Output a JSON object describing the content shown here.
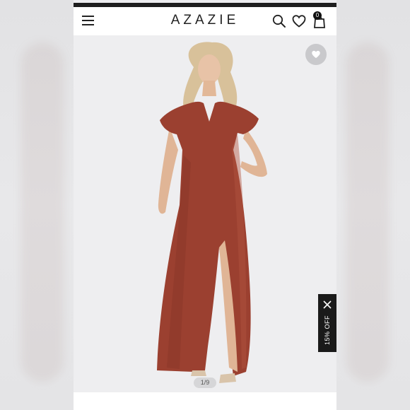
{
  "header": {
    "logo": "AZAZIE",
    "bag_count": "0",
    "icons": [
      "menu-icon",
      "search-icon",
      "heart-icon",
      "bag-icon"
    ]
  },
  "product": {
    "dress_color": "#9b4030",
    "wishlist_icon": "heart-icon"
  },
  "promo": {
    "label": "15% OFF",
    "close_icon": "close-icon"
  },
  "gallery": {
    "pager": "1/9"
  }
}
